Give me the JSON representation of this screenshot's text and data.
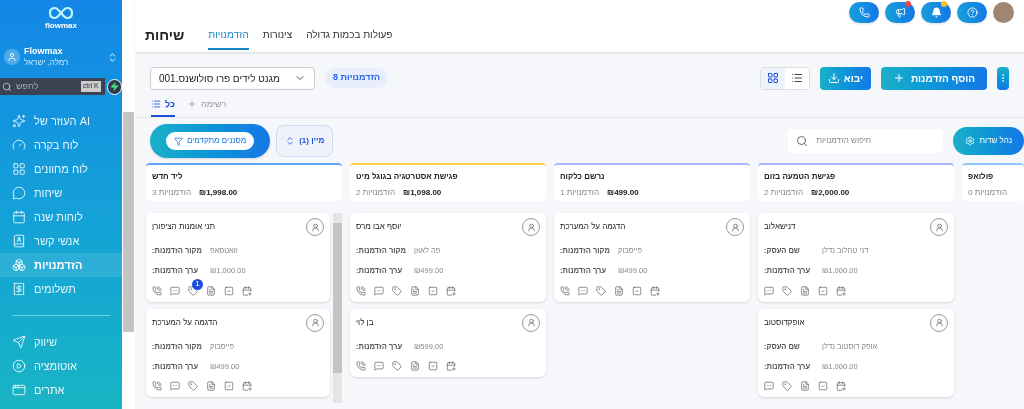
{
  "sidebar": {
    "brand": "flowmax",
    "account": {
      "name": "Flowmax",
      "location": "רמלה, ישראל"
    },
    "search": {
      "placeholder": "לחפש",
      "shortcut": "ctrl K"
    },
    "items": [
      {
        "label": "העוזר של AI",
        "selected": false
      },
      {
        "label": "לוח בקרה",
        "selected": false
      },
      {
        "label": "לוח מחוונים",
        "selected": false
      },
      {
        "label": "שיחות",
        "selected": false
      },
      {
        "label": "לוחות שנה",
        "selected": false
      },
      {
        "label": "אנשי קשר",
        "selected": false
      },
      {
        "label": "הזדמנויות",
        "selected": true
      },
      {
        "label": "תשלומים",
        "selected": false
      }
    ],
    "items_lower": [
      {
        "label": "שיווק",
        "selected": false
      },
      {
        "label": "אוטומציה",
        "selected": false
      },
      {
        "label": "אתרים",
        "selected": false
      }
    ]
  },
  "top_actions": [
    {
      "kind": "phone"
    },
    {
      "kind": "megaphone",
      "color": "#ef4444"
    },
    {
      "kind": "bell",
      "color": "#fbbf24"
    },
    {
      "kind": "help"
    }
  ],
  "page_title": "שיחות",
  "tabs": [
    {
      "label": "פעולות בכמות גדולה",
      "selected": false
    },
    {
      "label": "צינורות",
      "selected": false
    },
    {
      "label": "הזדמנויות",
      "selected": true
    }
  ],
  "toolbar": {
    "pipeline": "מגנט לידים פרו סולושנס.001",
    "count_badge": "הזדמנויות 8",
    "views": [
      {
        "kind": "grid",
        "selected": true
      },
      {
        "kind": "list",
        "selected": false
      }
    ],
    "import_button": "יבוא",
    "add_button": "הוסף הזדמנות"
  },
  "subtabs": [
    {
      "label": "רשימה",
      "selected": false
    },
    {
      "label": "כל",
      "selected": true
    }
  ],
  "filters": {
    "advanced": "מסננים מתקדמים",
    "sort": "מיין (1)",
    "search_placeholder": "חיפוש הזדמנויות",
    "manage_fields": "נהל שדות"
  },
  "columns": [
    {
      "title": "פולואפ",
      "color": "#93c5fd",
      "count": "הזדמנויות 0"
    },
    {
      "title": "פגישת הטמעה בזום",
      "color": "#a5b4fc",
      "total": "₪2,000.00",
      "count": "הזדמנויות 2",
      "cards": [
        {
          "title": "דנישאלוב",
          "fields": [
            {
              "label": "שם העסק:",
              "value": "דני טחלוב נדלן"
            },
            {
              "label": "ערך הזדמנות:",
              "value": "₪1,000.00"
            }
          ],
          "actions": [
            {
              "kind": "chat"
            },
            {
              "kind": "tag"
            },
            {
              "kind": "note"
            },
            {
              "kind": "task"
            },
            {
              "kind": "event"
            }
          ]
        },
        {
          "title": "אופקדוסטוב",
          "fields": [
            {
              "label": "שם העסק:",
              "value": "אופק דוסטוב נדלן"
            },
            {
              "label": "ערך הזדמנות:",
              "value": "₪1,000.00"
            }
          ],
          "actions": [
            {
              "kind": "chat"
            },
            {
              "kind": "tag"
            },
            {
              "kind": "note"
            },
            {
              "kind": "task"
            },
            {
              "kind": "event"
            }
          ]
        }
      ]
    },
    {
      "title": "נרשם כלקוח",
      "color": "#a5b4fc",
      "total": "₪499.00",
      "count": "הזדמנויות 1",
      "cards": [
        {
          "title": "הדגמה על המערכת",
          "fields": [
            {
              "label": "מקור הזדמנות:",
              "value": "פייסבוק"
            },
            {
              "label": "ערך הזדמנות:",
              "value": "₪499.00"
            }
          ],
          "actions": [
            {
              "kind": "phone"
            },
            {
              "kind": "chat"
            },
            {
              "kind": "tag"
            },
            {
              "kind": "note"
            },
            {
              "kind": "task"
            },
            {
              "kind": "event"
            }
          ]
        }
      ]
    },
    {
      "title": "פגישת אסטרטגיה בגוגל מיט",
      "color": "#fcd34d",
      "total": "₪1,098.00",
      "count": "הזדמנויות 2",
      "cards": [
        {
          "title": "יוסף אבו מרס",
          "fields": [
            {
              "label": "מקור הזדמנות:",
              "value": "פה לאוזן"
            },
            {
              "label": "ערך הזדמנות:",
              "value": "₪499.00"
            }
          ],
          "actions": [
            {
              "kind": "phone"
            },
            {
              "kind": "chat"
            },
            {
              "kind": "tag"
            },
            {
              "kind": "note"
            },
            {
              "kind": "task"
            },
            {
              "kind": "event"
            }
          ]
        },
        {
          "title": "בן לוי",
          "fields": [
            {
              "label": "ערך הזדמנות:",
              "value": "₪599.00"
            }
          ],
          "actions": [
            {
              "kind": "phone"
            },
            {
              "kind": "chat"
            },
            {
              "kind": "tag"
            },
            {
              "kind": "note"
            },
            {
              "kind": "task"
            },
            {
              "kind": "event"
            }
          ]
        }
      ]
    },
    {
      "title": "ליד חדש",
      "color": "#60a5fa",
      "total": "₪1,998.00",
      "count": "הזדמנויות 3",
      "cards": [
        {
          "title": "תני אומנות הציפורן",
          "fields": [
            {
              "label": "מקור הזדמנות:",
              "value": "וואטסאפ"
            },
            {
              "label": "ערך הזדמנות:",
              "value": "₪1,000.00"
            }
          ],
          "actions": [
            {
              "kind": "phone"
            },
            {
              "kind": "chat"
            },
            {
              "kind": "tag",
              "badge": "1"
            },
            {
              "kind": "note"
            },
            {
              "kind": "task"
            },
            {
              "kind": "event"
            }
          ]
        },
        {
          "title": "הדגמה על המערכת",
          "fields": [
            {
              "label": "מקור הזדמנות:",
              "value": "פייסבוק"
            },
            {
              "label": "ערך הזדמנות:",
              "value": "₪499.00"
            }
          ],
          "actions": [
            {
              "kind": "phone"
            },
            {
              "kind": "chat"
            },
            {
              "kind": "tag"
            },
            {
              "kind": "note"
            },
            {
              "kind": "task"
            },
            {
              "kind": "event"
            }
          ]
        }
      ]
    }
  ]
}
